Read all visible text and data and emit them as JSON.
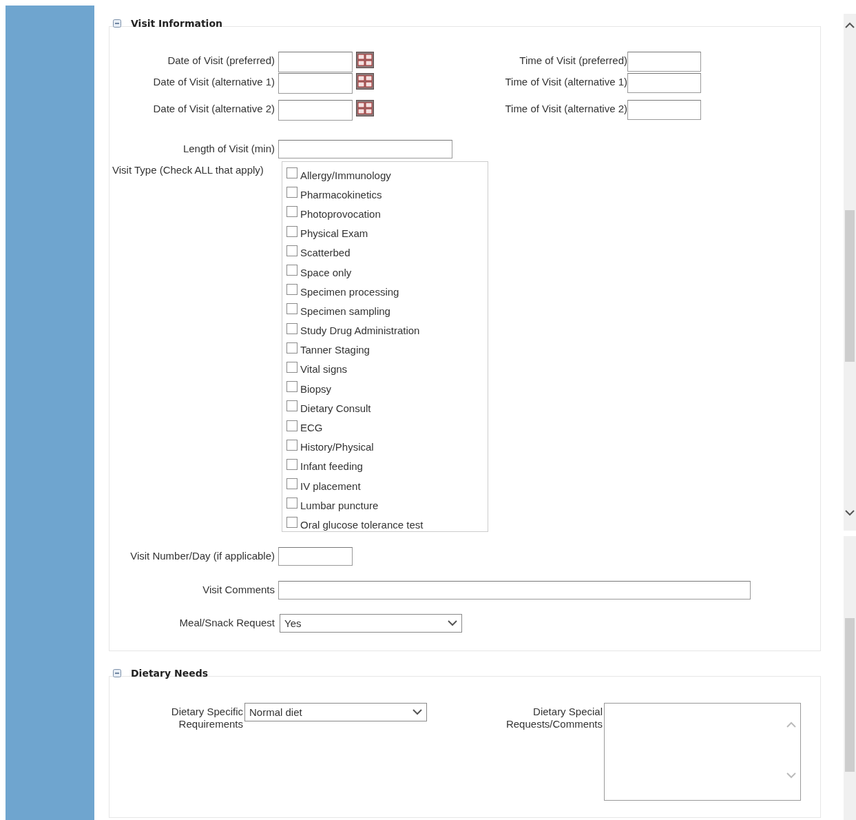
{
  "visit_information": {
    "title": "Visit Information",
    "expanded": true,
    "date_fields": [
      {
        "label": "Date of Visit (preferred)"
      },
      {
        "label": "Date of Visit (alternative 1)"
      },
      {
        "label": "Date of Visit (alternative 2)"
      }
    ],
    "time_fields": [
      {
        "label": "Time of Visit (preferred)"
      },
      {
        "label": "Time of Visit (alternative 1)"
      },
      {
        "label": "Time of Visit (alternative 2)"
      }
    ],
    "length_of_visit": {
      "label": "Length of Visit (min)"
    },
    "visit_type": {
      "label": "Visit Type (Check ALL that apply)",
      "options": [
        {
          "label": "Allergy/Immunology",
          "checked": false
        },
        {
          "label": "Pharmacokinetics",
          "checked": false
        },
        {
          "label": "Photoprovocation",
          "checked": false
        },
        {
          "label": "Physical Exam",
          "checked": false
        },
        {
          "label": "Scatterbed",
          "checked": false
        },
        {
          "label": "Space only",
          "checked": false
        },
        {
          "label": "Specimen processing",
          "checked": false
        },
        {
          "label": "Specimen sampling",
          "checked": false
        },
        {
          "label": "Study Drug Administration",
          "checked": false
        },
        {
          "label": "Tanner Staging",
          "checked": false
        },
        {
          "label": "Vital signs",
          "checked": false
        },
        {
          "label": "Biopsy",
          "checked": false
        },
        {
          "label": "Dietary Consult",
          "checked": false
        },
        {
          "label": "ECG",
          "checked": false
        },
        {
          "label": "History/Physical",
          "checked": false
        },
        {
          "label": "Infant feeding",
          "checked": false
        },
        {
          "label": "IV placement",
          "checked": false
        },
        {
          "label": "Lumbar puncture",
          "checked": false
        },
        {
          "label": "Oral glucose tolerance test",
          "checked": false
        }
      ]
    },
    "visit_number": {
      "label": "Visit Number/Day (if applicable)"
    },
    "visit_comments": {
      "label": "Visit Comments"
    },
    "meal_snack_request": {
      "label": "Meal/Snack Request",
      "value": "Yes"
    }
  },
  "dietary_needs": {
    "title": "Dietary Needs",
    "expanded": true,
    "specific_requirements": {
      "label": "Dietary Specific Requirements",
      "value": "Normal diet"
    },
    "special_requests": {
      "label": "Dietary Special Requests/Comments"
    }
  }
}
